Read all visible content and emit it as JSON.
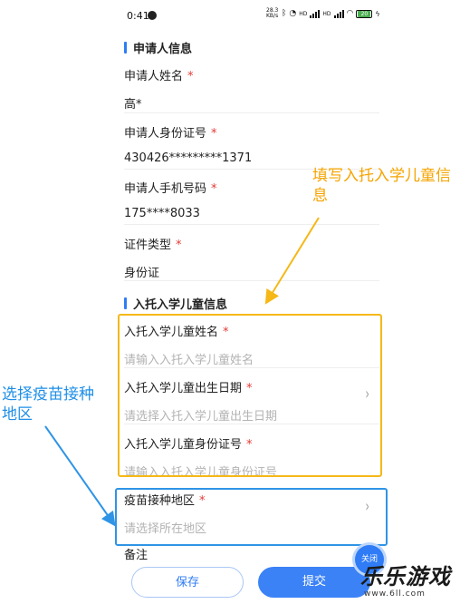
{
  "status_bar": {
    "time": "0:41",
    "net_speed": "28.3\nKB/s",
    "sig1": "HD",
    "sig2": "HD",
    "battery": "20"
  },
  "applicant_section": {
    "title": "申请人信息",
    "fields": [
      {
        "label": "申请人姓名",
        "value": "高*",
        "required": "*"
      },
      {
        "label": "申请人身份证号",
        "value": "430426*********1371",
        "required": "*"
      },
      {
        "label": "申请人手机号码",
        "value": "175****8033",
        "required": "*"
      },
      {
        "label": "证件类型",
        "value": "身份证",
        "required": "*"
      }
    ]
  },
  "child_section": {
    "title": "入托入学儿童信息",
    "fields": [
      {
        "label": "入托入学儿童姓名",
        "placeholder": "请输入入托入学儿童姓名",
        "required": "*"
      },
      {
        "label": "入托入学儿童出生日期",
        "placeholder": "请选择入托入学儿童出生日期",
        "required": "*"
      },
      {
        "label": "入托入学儿童身份证号",
        "placeholder": "请输入入托入学儿童身份证号",
        "required": "*"
      }
    ]
  },
  "vaccine_field": {
    "label": "疫苗接种地区",
    "placeholder": "请选择所在地区",
    "required": "*"
  },
  "remarks_label": "备注",
  "annotations": {
    "yellow": "填写入托入学儿童信息",
    "blue": "选择疫苗接种地区"
  },
  "buttons": {
    "save": "保存",
    "submit": "提交",
    "close": "关闭"
  },
  "watermark": {
    "text": "乐乐游戏",
    "url": "www.6ll.com"
  },
  "colors": {
    "accent": "#2f7cf6",
    "highlight_yellow": "#f5b817",
    "highlight_blue": "#2f94e6",
    "required": "#e53935"
  }
}
